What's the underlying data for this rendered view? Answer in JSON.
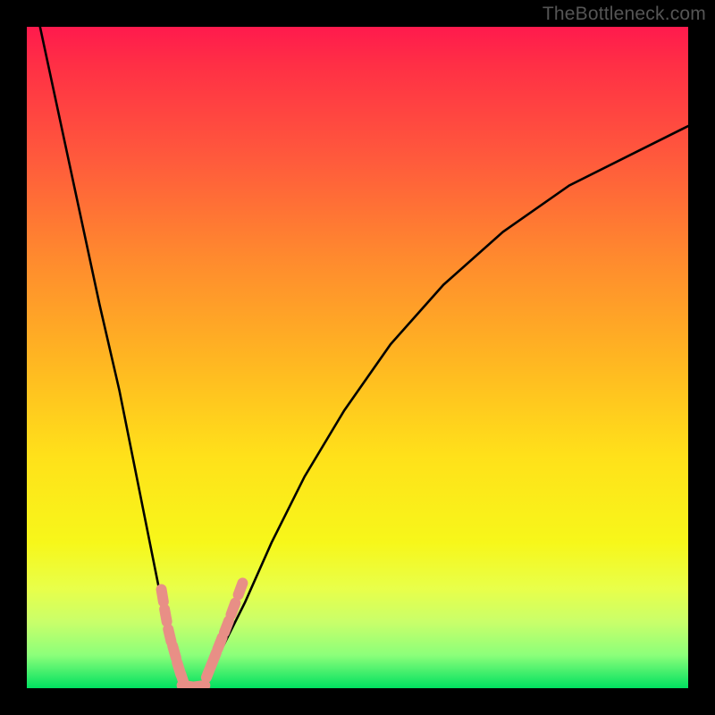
{
  "watermark": "TheBottleneck.com",
  "chart_data": {
    "type": "line",
    "title": "",
    "xlabel": "",
    "ylabel": "",
    "xlim": [
      0,
      100
    ],
    "ylim": [
      0,
      100
    ],
    "grid": false,
    "series": [
      {
        "name": "bottleneck-curve",
        "x": [
          2,
          5,
          8,
          11,
          14,
          16,
          18,
          20,
          21,
          22,
          23,
          24,
          25,
          26,
          27,
          28,
          30,
          33,
          37,
          42,
          48,
          55,
          63,
          72,
          82,
          92,
          100
        ],
        "y": [
          100,
          86,
          72,
          58,
          45,
          35,
          25,
          15,
          10,
          6,
          3,
          1,
          0,
          0,
          1,
          3,
          7,
          13,
          22,
          32,
          42,
          52,
          61,
          69,
          76,
          81,
          85
        ]
      },
      {
        "name": "highlight-markers-left",
        "x": [
          20.5,
          21.0,
          21.6,
          22.3,
          23.0,
          23.6
        ],
        "y": [
          14.0,
          11.0,
          8.0,
          5.5,
          3.0,
          1.2
        ]
      },
      {
        "name": "highlight-markers-bottom",
        "x": [
          24.4,
          25.2,
          26.0
        ],
        "y": [
          0.3,
          0.2,
          0.3
        ]
      },
      {
        "name": "highlight-markers-right",
        "x": [
          27.5,
          28.3,
          29.2,
          30.2,
          31.2,
          32.3
        ],
        "y": [
          2.5,
          4.5,
          6.8,
          9.3,
          12.0,
          15.0
        ]
      }
    ],
    "gradient_axis": "y",
    "gradient_stops": [
      {
        "pos": 0.0,
        "color": "#00e060"
      },
      {
        "pos": 0.05,
        "color": "#8cff7a"
      },
      {
        "pos": 0.12,
        "color": "#e8ff4a"
      },
      {
        "pos": 0.25,
        "color": "#ffe11a"
      },
      {
        "pos": 0.45,
        "color": "#ffb522"
      },
      {
        "pos": 0.65,
        "color": "#ff8a2e"
      },
      {
        "pos": 0.82,
        "color": "#ff5a3c"
      },
      {
        "pos": 1.0,
        "color": "#ff1a4d"
      }
    ],
    "marker_style": {
      "color": "#e88f86",
      "shape": "rounded-capsule"
    }
  }
}
